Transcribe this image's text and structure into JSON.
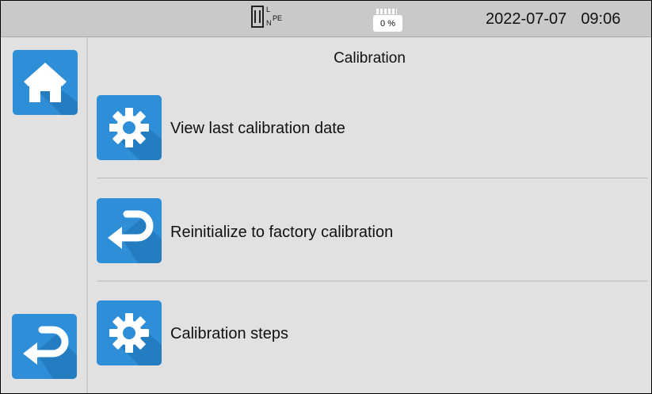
{
  "status": {
    "wiring_labels": {
      "l": "L",
      "n": "N",
      "pe": "PE"
    },
    "battery": "0 %",
    "date": "2022-07-07",
    "time": "09:06"
  },
  "title": "Calibration",
  "menu": [
    {
      "label": "View last calibration date",
      "icon": "gear-icon"
    },
    {
      "label": "Reinitialize to factory calibration",
      "icon": "return-arrow-icon"
    },
    {
      "label": "Calibration steps",
      "icon": "gear-icon"
    }
  ],
  "nav": {
    "home_icon": "home-icon",
    "back_icon": "return-arrow-icon"
  },
  "colors": {
    "tile": "#2e8fd8",
    "background": "#e1e1e1",
    "statusbar": "#c9c9c9"
  }
}
